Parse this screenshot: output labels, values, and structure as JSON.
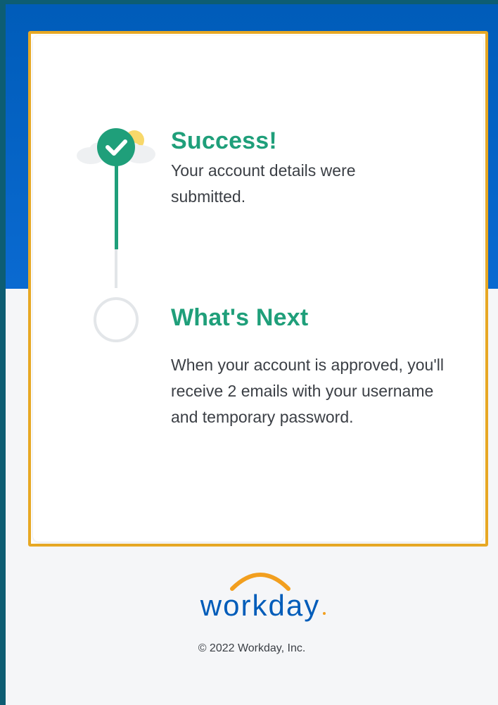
{
  "steps": [
    {
      "title": "Success!",
      "text": "Your account details were submitted.",
      "status": "complete"
    },
    {
      "title": "What's Next",
      "text": "When your account is approved, you'll receive 2 emails with your username and temporary password.",
      "status": "pending"
    }
  ],
  "footer": {
    "logo_text": "workday",
    "copyright": "© 2022 Workday, Inc."
  },
  "colors": {
    "brand_blue": "#005cb9",
    "success_green": "#1f9f7a",
    "highlight_orange": "#e7a824",
    "logo_orange": "#f29f1f"
  },
  "icons": {
    "step1": "check-circle-icon",
    "step2": "empty-circle-icon"
  }
}
